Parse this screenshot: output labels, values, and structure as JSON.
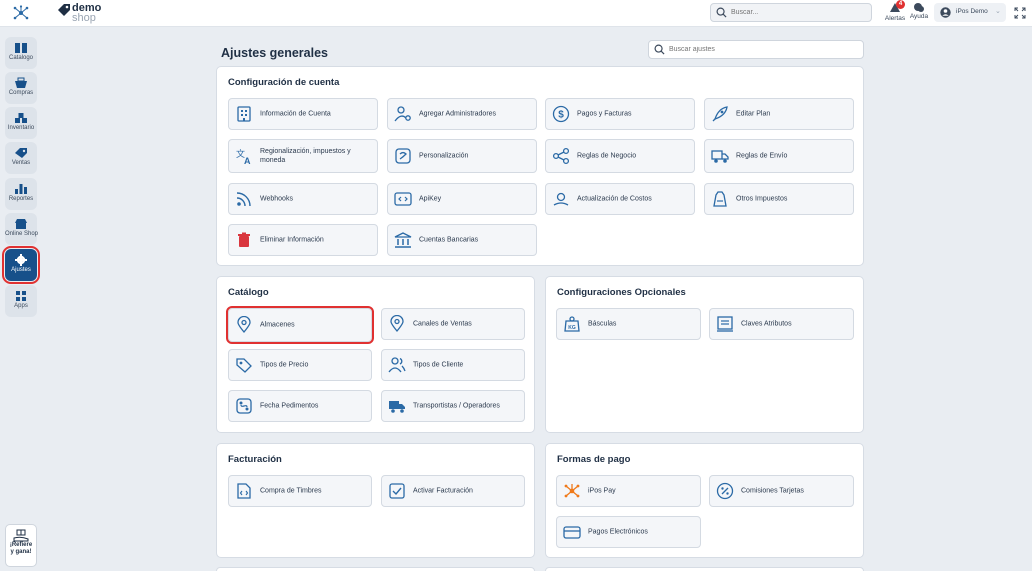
{
  "brand": {
    "line1": "demo",
    "line2": "shop"
  },
  "topbar": {
    "search_placeholder": "Buscar...",
    "alerts_label": "Alertas",
    "alerts_count": "4",
    "help_label": "Ayuda",
    "user_name": "iPos Demo"
  },
  "sidebar": {
    "items": [
      {
        "label": "Catalogo"
      },
      {
        "label": "Compras"
      },
      {
        "label": "Inventario"
      },
      {
        "label": "Ventas"
      },
      {
        "label": "Reportes"
      },
      {
        "label": "Online Shop"
      },
      {
        "label": "Ajustes"
      },
      {
        "label": "Apps"
      }
    ],
    "refer_line1": "¡Refiere",
    "refer_line2": "y gana!"
  },
  "page": {
    "title": "Ajustes generales",
    "search_placeholder": "Buscar ajustes"
  },
  "sections": {
    "cuenta": {
      "title": "Configuración de cuenta",
      "items": [
        "Información de Cuenta",
        "Agregar Administradores",
        "Pagos y Facturas",
        "Editar Plan",
        "Regionalización, impuestos y moneda",
        "Personalización",
        "Reglas de Negocio",
        "Reglas de Envío",
        "Webhooks",
        "ApiKey",
        "Actualización de Costos",
        "Otros Impuestos",
        "Eliminar Información",
        "Cuentas Bancarias"
      ]
    },
    "catalogo": {
      "title": "Catálogo",
      "items": [
        "Almacenes",
        "Canales de Ventas",
        "Tipos de Precio",
        "Tipos de Cliente",
        "Fecha Pedimentos",
        "Transportistas / Operadores"
      ]
    },
    "opcionales": {
      "title": "Configuraciones Opcionales",
      "items": [
        "Básculas",
        "Claves Atributos"
      ]
    },
    "facturacion": {
      "title": "Facturación",
      "items": [
        "Compra de Timbres",
        "Activar Facturación"
      ]
    },
    "pago": {
      "title": "Formas de pago",
      "items": [
        "iPos Pay",
        "Comisiones Tarjetas",
        "Pagos Electrónicos"
      ]
    }
  },
  "colors": {
    "accent": "#17508a",
    "icon": "#2b6aa6",
    "highlight": "#e03131",
    "delete": "#d9363e",
    "ipos_pay": "#f07a1a"
  }
}
